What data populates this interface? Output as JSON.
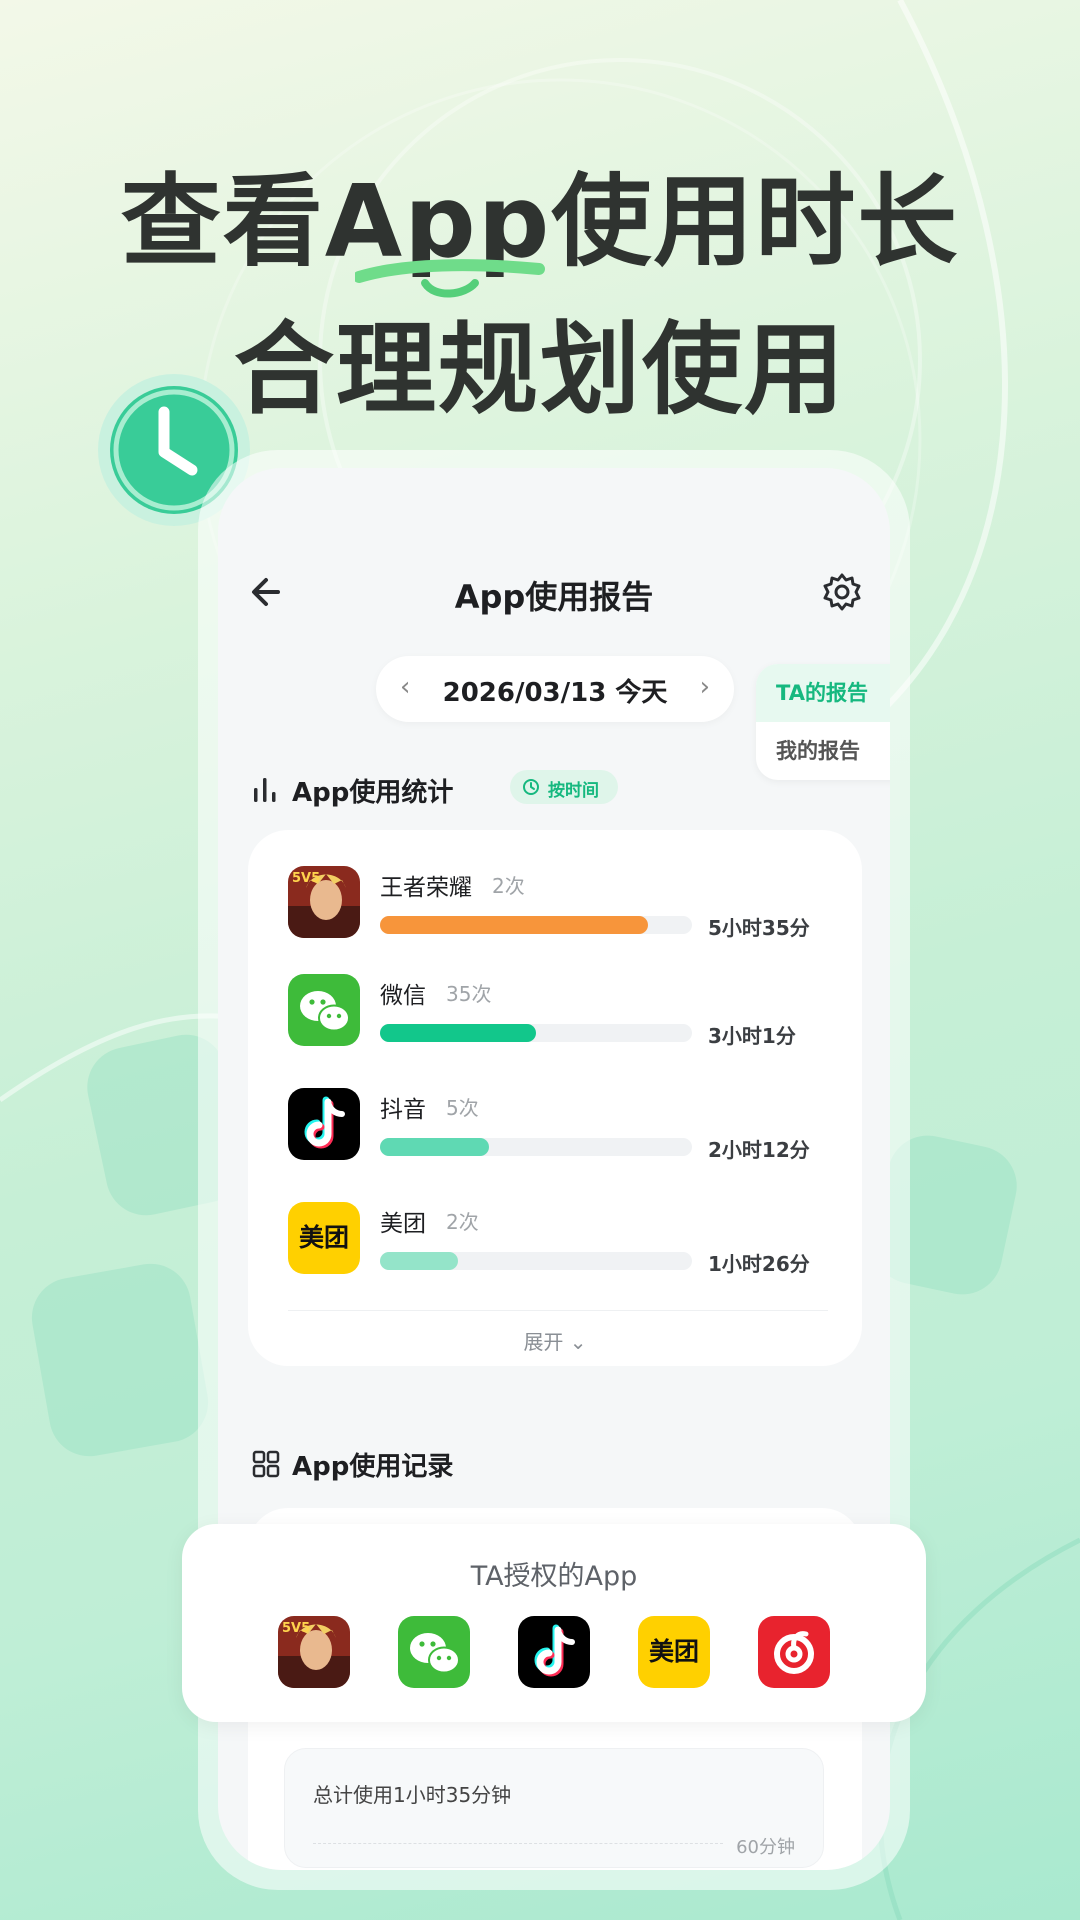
{
  "headline": {
    "line1": "查看App使用时长",
    "line2": "合理规划使用"
  },
  "nav": {
    "title": "App使用报告"
  },
  "date_picker": {
    "date": "2026/03/13 今天",
    "prev": "‹",
    "next": "›"
  },
  "report_switch": {
    "active": "TA的报告",
    "inactive": "我的报告"
  },
  "stats": {
    "title": "App使用统计",
    "chip": "按时间",
    "apps": [
      {
        "name": "王者荣耀",
        "count": "2次",
        "time": "5小时35分",
        "fill": 0.86,
        "color": "#f7953b"
      },
      {
        "name": "微信",
        "count": "35次",
        "time": "3小时1分",
        "fill": 0.5,
        "color": "#12c78b"
      },
      {
        "name": "抖音",
        "count": "5次",
        "time": "2小时12分",
        "fill": 0.35,
        "color": "#5fd9b3"
      },
      {
        "name": "美团",
        "count": "2次",
        "time": "1小时26分",
        "fill": 0.25,
        "color": "#94e4c9"
      }
    ],
    "expand": "展开 ⌄"
  },
  "records": {
    "title": "App使用记录",
    "total": "总计使用1小时35分钟",
    "axis_label": "60分钟"
  },
  "authorized": {
    "title": "TA授权的App",
    "icons": [
      "honor-of-kings-icon",
      "wechat-icon",
      "douyin-icon",
      "meituan-icon",
      "netease-music-icon"
    ],
    "meituan_text": "美团"
  }
}
